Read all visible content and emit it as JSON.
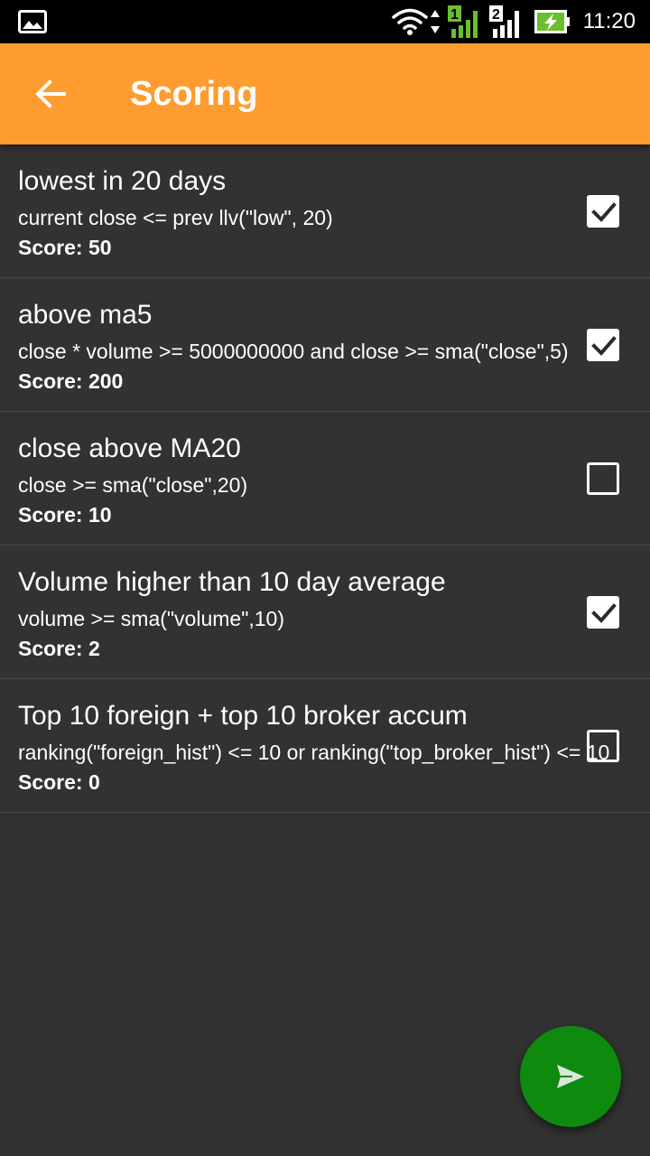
{
  "status_bar": {
    "time": "11:20",
    "sim1_label": "1",
    "sim2_label": "2",
    "icons": [
      "image-icon",
      "wifi-icon",
      "signal-sim1-icon",
      "signal-sim2-icon",
      "battery-charging-icon"
    ]
  },
  "app_bar": {
    "title": "Scoring",
    "back_icon": "arrow-left-icon",
    "color": "#FF9C2F"
  },
  "rules": [
    {
      "title": "lowest in 20 days",
      "expression": "current close <= prev llv(\"low\", 20)",
      "score": "Score: 50",
      "checked": true
    },
    {
      "title": "above ma5",
      "expression": "close * volume >= 5000000000 and close >= sma(\"close\",5)",
      "score": "Score: 200",
      "checked": true
    },
    {
      "title": "close above MA20",
      "expression": "close >= sma(\"close\",20)",
      "score": "Score: 10",
      "checked": false
    },
    {
      "title": "Volume higher than 10 day average",
      "expression": "volume >= sma(\"volume\",10)",
      "score": "Score: 2",
      "checked": true
    },
    {
      "title": "Top 10 foreign + top 10 broker accum",
      "expression": "ranking(\"foreign_hist\") <= 10 or ranking(\"top_broker_hist\") <= 10",
      "score": "Score: 0",
      "checked": false
    }
  ],
  "fab": {
    "icon": "send-icon",
    "color": "#0E8A0E"
  }
}
